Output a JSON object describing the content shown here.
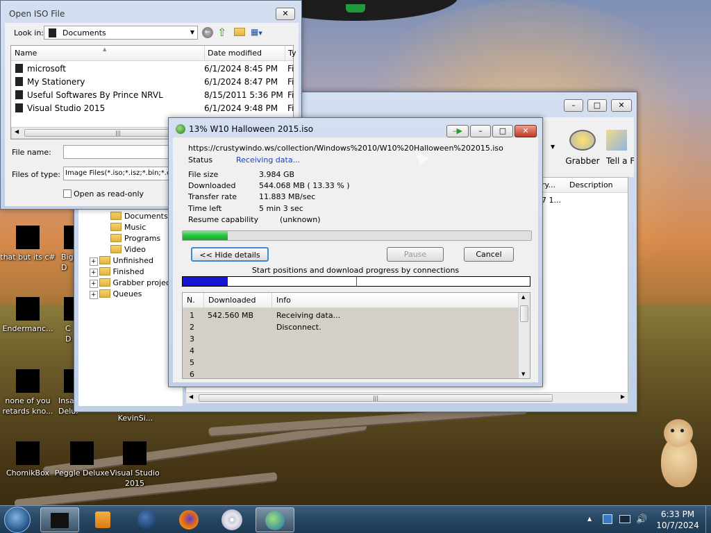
{
  "open_iso": {
    "title": "Open ISO File",
    "look_in_label": "Look in:",
    "look_in_value": "Documents",
    "columns": [
      "Name",
      "Date modified",
      "Ty"
    ],
    "rows": [
      {
        "name": "microsoft",
        "date": "6/1/2024 8:45 PM",
        "type": "Fi"
      },
      {
        "name": "My Stationery",
        "date": "6/1/2024 8:47 PM",
        "type": "Fi"
      },
      {
        "name": "Useful Softwares By Prince NRVL",
        "date": "8/15/2011 5:36 PM",
        "type": "Fi"
      },
      {
        "name": "Visual Studio 2015",
        "date": "6/1/2024 9:48 PM",
        "type": "Fi"
      }
    ],
    "file_name_label": "File name:",
    "files_of_type_label": "Files of type:",
    "files_of_type_value": "Image Files(*.iso;*.isz;*.bin;*.cue",
    "read_only_label": "Open as read-only"
  },
  "idm_main": {
    "toolbar": {
      "grabber": "Grabber",
      "tell": "Tell a Fr"
    },
    "columns": [
      "ry...",
      "Description"
    ],
    "row1": "7 1...",
    "tree": [
      "Documents",
      "Music",
      "Programs",
      "Video",
      "Unfinished",
      "Finished",
      "Grabber projects",
      "Queues"
    ]
  },
  "download": {
    "title": "13% W10 Halloween 2015.iso",
    "url": "https://crustywindo.ws/collection/Windows%2010/W10%20Halloween%202015.iso",
    "status_label": "Status",
    "status_value": "Receiving data...",
    "file_size_label": "File size",
    "file_size_value": "3.984  GB",
    "downloaded_label": "Downloaded",
    "downloaded_value": "544.068  MB  ( 13.33 % )",
    "transfer_label": "Transfer rate",
    "transfer_value": "11.883  MB/sec",
    "time_left_label": "Time left",
    "time_left_value": "5 min 3 sec",
    "resume_label": "Resume capability",
    "resume_value": "(unknown)",
    "progress_fraction": 0.13,
    "hide_details_label": "<< Hide details",
    "pause_label": "Pause",
    "cancel_label": "Cancel",
    "connections_caption": "Start positions and download progress by connections",
    "conn_columns": [
      "N.",
      "Downloaded",
      "Info"
    ],
    "connections": [
      {
        "n": "1",
        "downloaded": "542.560  MB",
        "info": "Receiving data..."
      },
      {
        "n": "2",
        "downloaded": "",
        "info": "Disconnect."
      },
      {
        "n": "3",
        "downloaded": "",
        "info": ""
      },
      {
        "n": "4",
        "downloaded": "",
        "info": ""
      },
      {
        "n": "5",
        "downloaded": "",
        "info": ""
      },
      {
        "n": "6",
        "downloaded": "",
        "info": ""
      }
    ]
  },
  "desktop_icons": [
    {
      "label": "that but its c#"
    },
    {
      "label": "Big D"
    },
    {
      "label": "Endermanc..."
    },
    {
      "label": "C D"
    },
    {
      "label": "none of you retards kno..."
    },
    {
      "label": "Insa Deluxe"
    },
    {
      "label": "KevinSi..."
    },
    {
      "label": "ChomikBox"
    },
    {
      "label": "Peggle Deluxe"
    },
    {
      "label": "Visual Studio 2015"
    }
  ],
  "clock": {
    "time": "6:33 PM",
    "date": "10/7/2024"
  },
  "colors": {
    "progress_green": "#22c43c",
    "conn_blue": "#1414d2",
    "status_blue": "#1a3fc4"
  }
}
